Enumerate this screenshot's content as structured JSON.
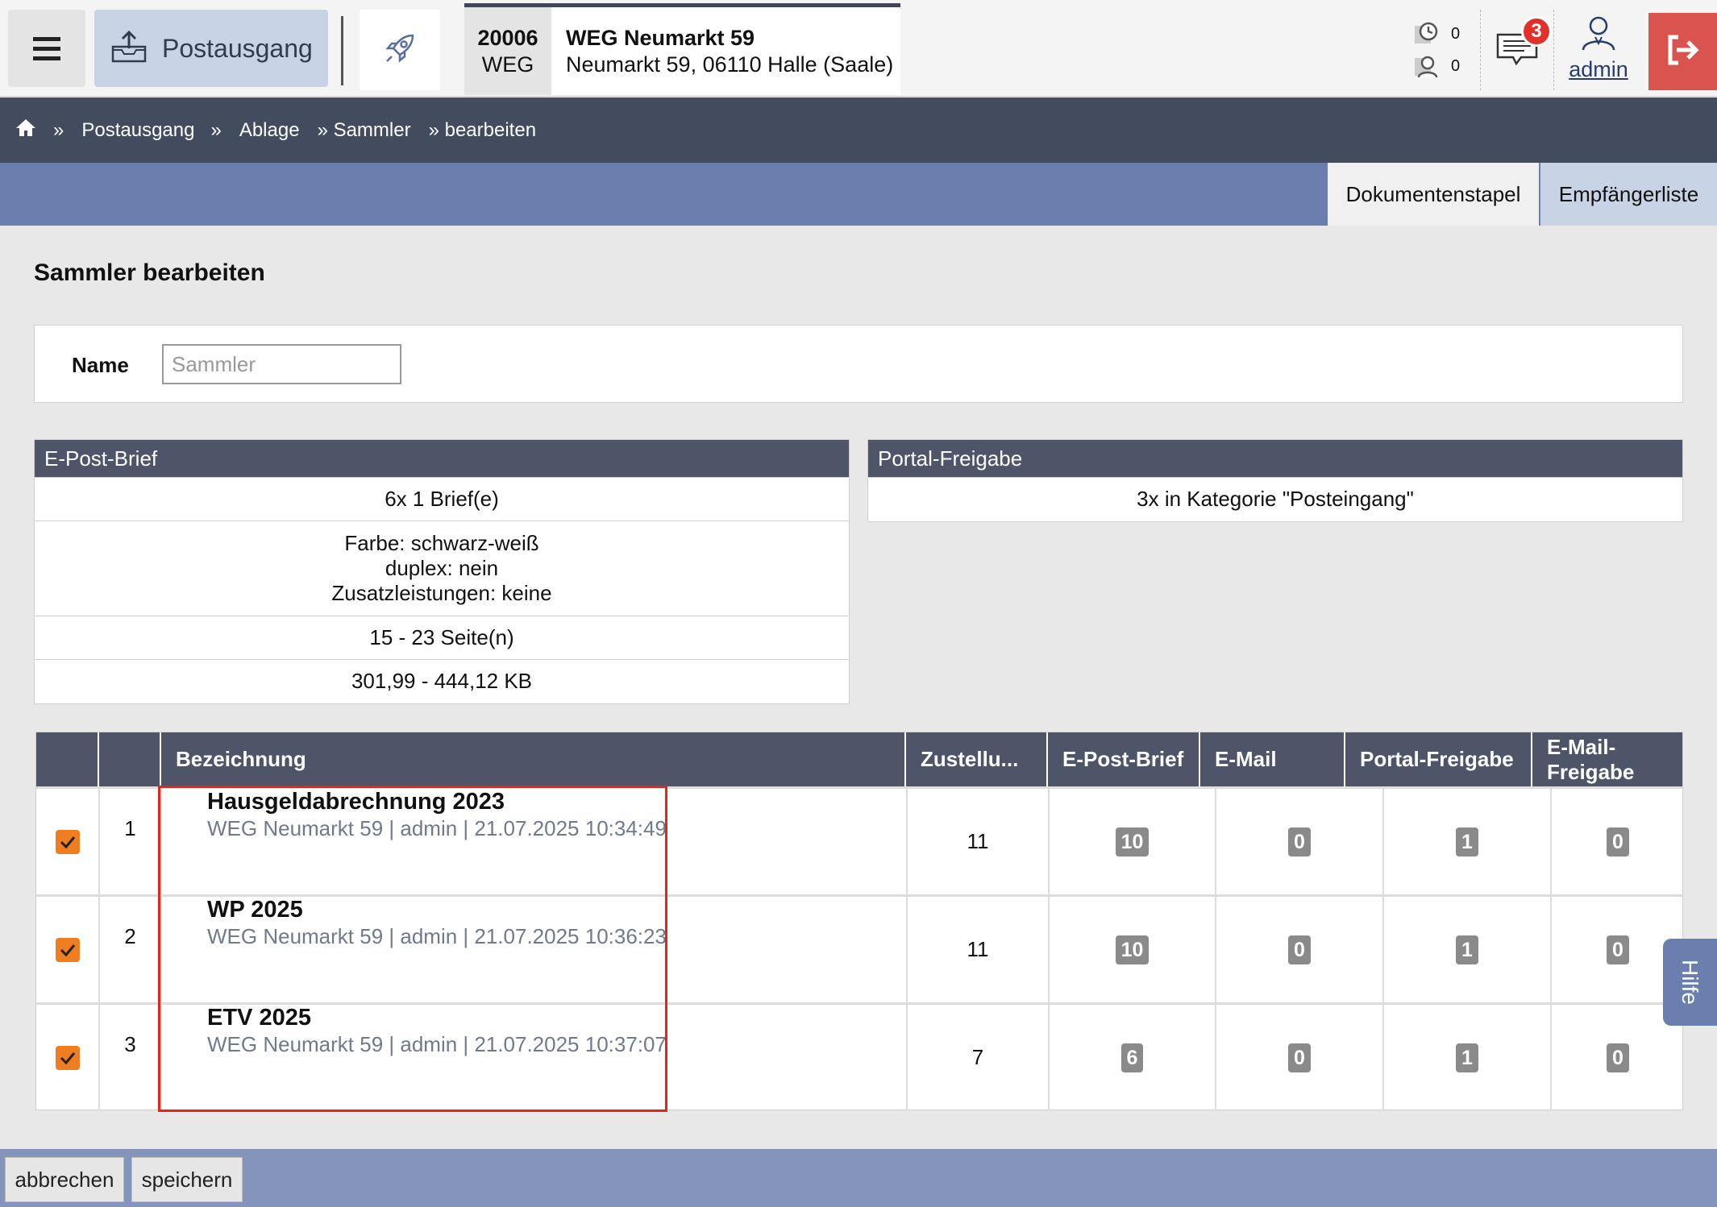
{
  "topbar": {
    "module_label": "Postausgang",
    "property_number": "20006",
    "property_type": "WEG",
    "property_name": "WEG Neumarkt 59",
    "property_address": "Neumarkt 59, 06110 Halle (Saale)",
    "counter_pending": "0",
    "counter_users": "0",
    "messages_badge": "3",
    "username": "admin"
  },
  "breadcrumb": {
    "sep": "»",
    "items": [
      "Postausgang",
      "Ablage",
      "» Sammler",
      "» bearbeiten"
    ]
  },
  "tabs": [
    "Dokumentenstapel",
    "Empfängerliste"
  ],
  "page_title": "Sammler bearbeiten",
  "name_field": {
    "label": "Name",
    "placeholder": "Sammler",
    "value": ""
  },
  "epost": {
    "title": "E-Post-Brief",
    "rows": [
      "6x 1 Brief(e)",
      "Farbe: schwarz-weiß",
      "duplex: nein",
      "Zusatzleistungen: keine",
      "15 - 23 Seite(n)",
      "301,99 - 444,12 KB"
    ]
  },
  "portal": {
    "title": "Portal-Freigabe",
    "rows": [
      "3x in Kategorie \"Posteingang\""
    ]
  },
  "table": {
    "headers": [
      "Bezeichnung",
      "Zustellu...",
      "E-Post-Brief",
      "E-Mail",
      "Portal-Freigabe",
      "E-Mail-Freigabe"
    ],
    "rows": [
      {
        "checked": true,
        "index": "1",
        "title": "Hausgeldabrechnung 2023",
        "meta": "WEG Neumarkt 59 | admin | 21.07.2025 10:34:49",
        "zustellung": "11",
        "epost": "10",
        "email": "0",
        "portal": "1",
        "email_freigabe": "0"
      },
      {
        "checked": true,
        "index": "2",
        "title": "WP 2025",
        "meta": "WEG Neumarkt 59 | admin | 21.07.2025 10:36:23",
        "zustellung": "11",
        "epost": "10",
        "email": "0",
        "portal": "1",
        "email_freigabe": "0"
      },
      {
        "checked": true,
        "index": "3",
        "title": "ETV 2025",
        "meta": "WEG Neumarkt 59 | admin | 21.07.2025 10:37:07",
        "zustellung": "7",
        "epost": "6",
        "email": "0",
        "portal": "1",
        "email_freigabe": "0"
      }
    ]
  },
  "help_label": "Hilfe",
  "footer": {
    "cancel": "abbrechen",
    "save": "speichern"
  },
  "colors": {
    "header_dark": "#434b5e",
    "accent_blue": "#6a7fad",
    "checkbox_orange": "#f07d1f",
    "logout_red": "#d9534f",
    "highlight_red": "#e3261d"
  }
}
